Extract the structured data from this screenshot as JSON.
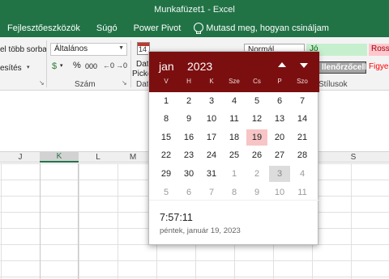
{
  "window": {
    "title": "Munkafüzet1  -  Excel"
  },
  "ribbon_tabs": {
    "developer": "Fejlesztőeszközök",
    "help": "Súgó",
    "power_pivot": "Power Pivot",
    "tell_me": "Mutasd meg, hogyan csináljam"
  },
  "ribbon": {
    "wrap_text": "el több sorba",
    "merge": "esítés",
    "number_format": "Általános",
    "number_group": "Szám",
    "date_picker_label_1": "Dat",
    "date_picker_label_2": "Picke",
    "date_picker_group": "Dat",
    "calendar_icon_number": "14",
    "styles_group": "Stílusok",
    "percent": "%",
    "thousands": "000",
    "currency": "$"
  },
  "styles": {
    "normal": "Normál",
    "good": "Jó",
    "bad": "Rossz",
    "check_cell": "llenőrzőcella",
    "warning": "Figye"
  },
  "columns": [
    "J",
    "K",
    "L",
    "M",
    "S"
  ],
  "selected_column": "K",
  "datepicker": {
    "month": "jan",
    "year": "2023",
    "weekdays": [
      "V",
      "H",
      "K",
      "Sze",
      "Cs",
      "P",
      "Szo"
    ],
    "weeks": [
      [
        "1",
        "2",
        "3",
        "4",
        "5",
        "6",
        "7"
      ],
      [
        "8",
        "9",
        "10",
        "11",
        "12",
        "13",
        "14"
      ],
      [
        "15",
        "16",
        "17",
        "18",
        "19",
        "20",
        "21"
      ],
      [
        "22",
        "23",
        "24",
        "25",
        "26",
        "27",
        "28"
      ],
      [
        "29",
        "30",
        "31",
        "1",
        "2",
        "3",
        "4"
      ],
      [
        "5",
        "6",
        "7",
        "8",
        "9",
        "10",
        "11"
      ]
    ],
    "selected_day": "19",
    "today_day": "3",
    "time": "7:57:11",
    "full_date": "péntek, január 19, 2023",
    "colors": {
      "header": "#7b0f0f",
      "selected": "#f7c5c5",
      "today": "#dcdcdc"
    }
  }
}
